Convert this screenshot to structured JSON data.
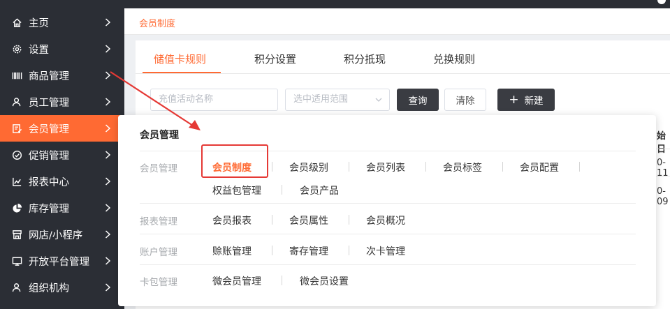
{
  "colors": {
    "accent": "#ff6a33",
    "sidebar_bg": "#2b2e35",
    "highlight": "#e53935"
  },
  "sidebar": {
    "items": [
      {
        "label": "主页",
        "icon": "home-icon",
        "active": false
      },
      {
        "label": "设置",
        "icon": "gear-icon",
        "active": false
      },
      {
        "label": "商品管理",
        "icon": "barcode-icon",
        "active": false
      },
      {
        "label": "员工管理",
        "icon": "staff-icon",
        "active": false
      },
      {
        "label": "会员管理",
        "icon": "member-card-icon",
        "active": true
      },
      {
        "label": "促销管理",
        "icon": "check-circle-icon",
        "active": false
      },
      {
        "label": "报表中心",
        "icon": "chart-icon",
        "active": false
      },
      {
        "label": "库存管理",
        "icon": "pie-chart-icon",
        "active": false
      },
      {
        "label": "网店/小程序",
        "icon": "shop-icon",
        "active": false
      },
      {
        "label": "开放平台管理",
        "icon": "monitor-icon",
        "active": false
      },
      {
        "label": "组织机构",
        "icon": "organization-icon",
        "active": false
      }
    ]
  },
  "breadcrumb": "会员制度",
  "tabs": [
    {
      "label": "储值卡规则",
      "active": true
    },
    {
      "label": "积分设置",
      "active": false
    },
    {
      "label": "积分抵现",
      "active": false
    },
    {
      "label": "兑换规则",
      "active": false
    }
  ],
  "filters": {
    "name_placeholder": "充值活动名称",
    "scope_placeholder": "选中适用范围",
    "query_label": "查询",
    "clear_label": "清除",
    "new_label": "新建"
  },
  "table_fragments": {
    "header": "始日",
    "row1": "0-11",
    "row2": "0-09"
  },
  "menu": {
    "title": "会员管理",
    "groups": [
      {
        "label": "会员管理",
        "items": [
          "会员制度",
          "会员级别",
          "会员列表",
          "会员标签",
          "会员配置",
          "权益包管理",
          "会员产品"
        ]
      },
      {
        "label": "报表管理",
        "items": [
          "会员报表",
          "会员属性",
          "会员概况"
        ]
      },
      {
        "label": "账户管理",
        "items": [
          "赊账管理",
          "寄存管理",
          "次卡管理"
        ]
      },
      {
        "label": "卡包管理",
        "items": [
          "微会员管理",
          "微会员设置"
        ]
      }
    ],
    "highlighted_item": "会员制度"
  }
}
